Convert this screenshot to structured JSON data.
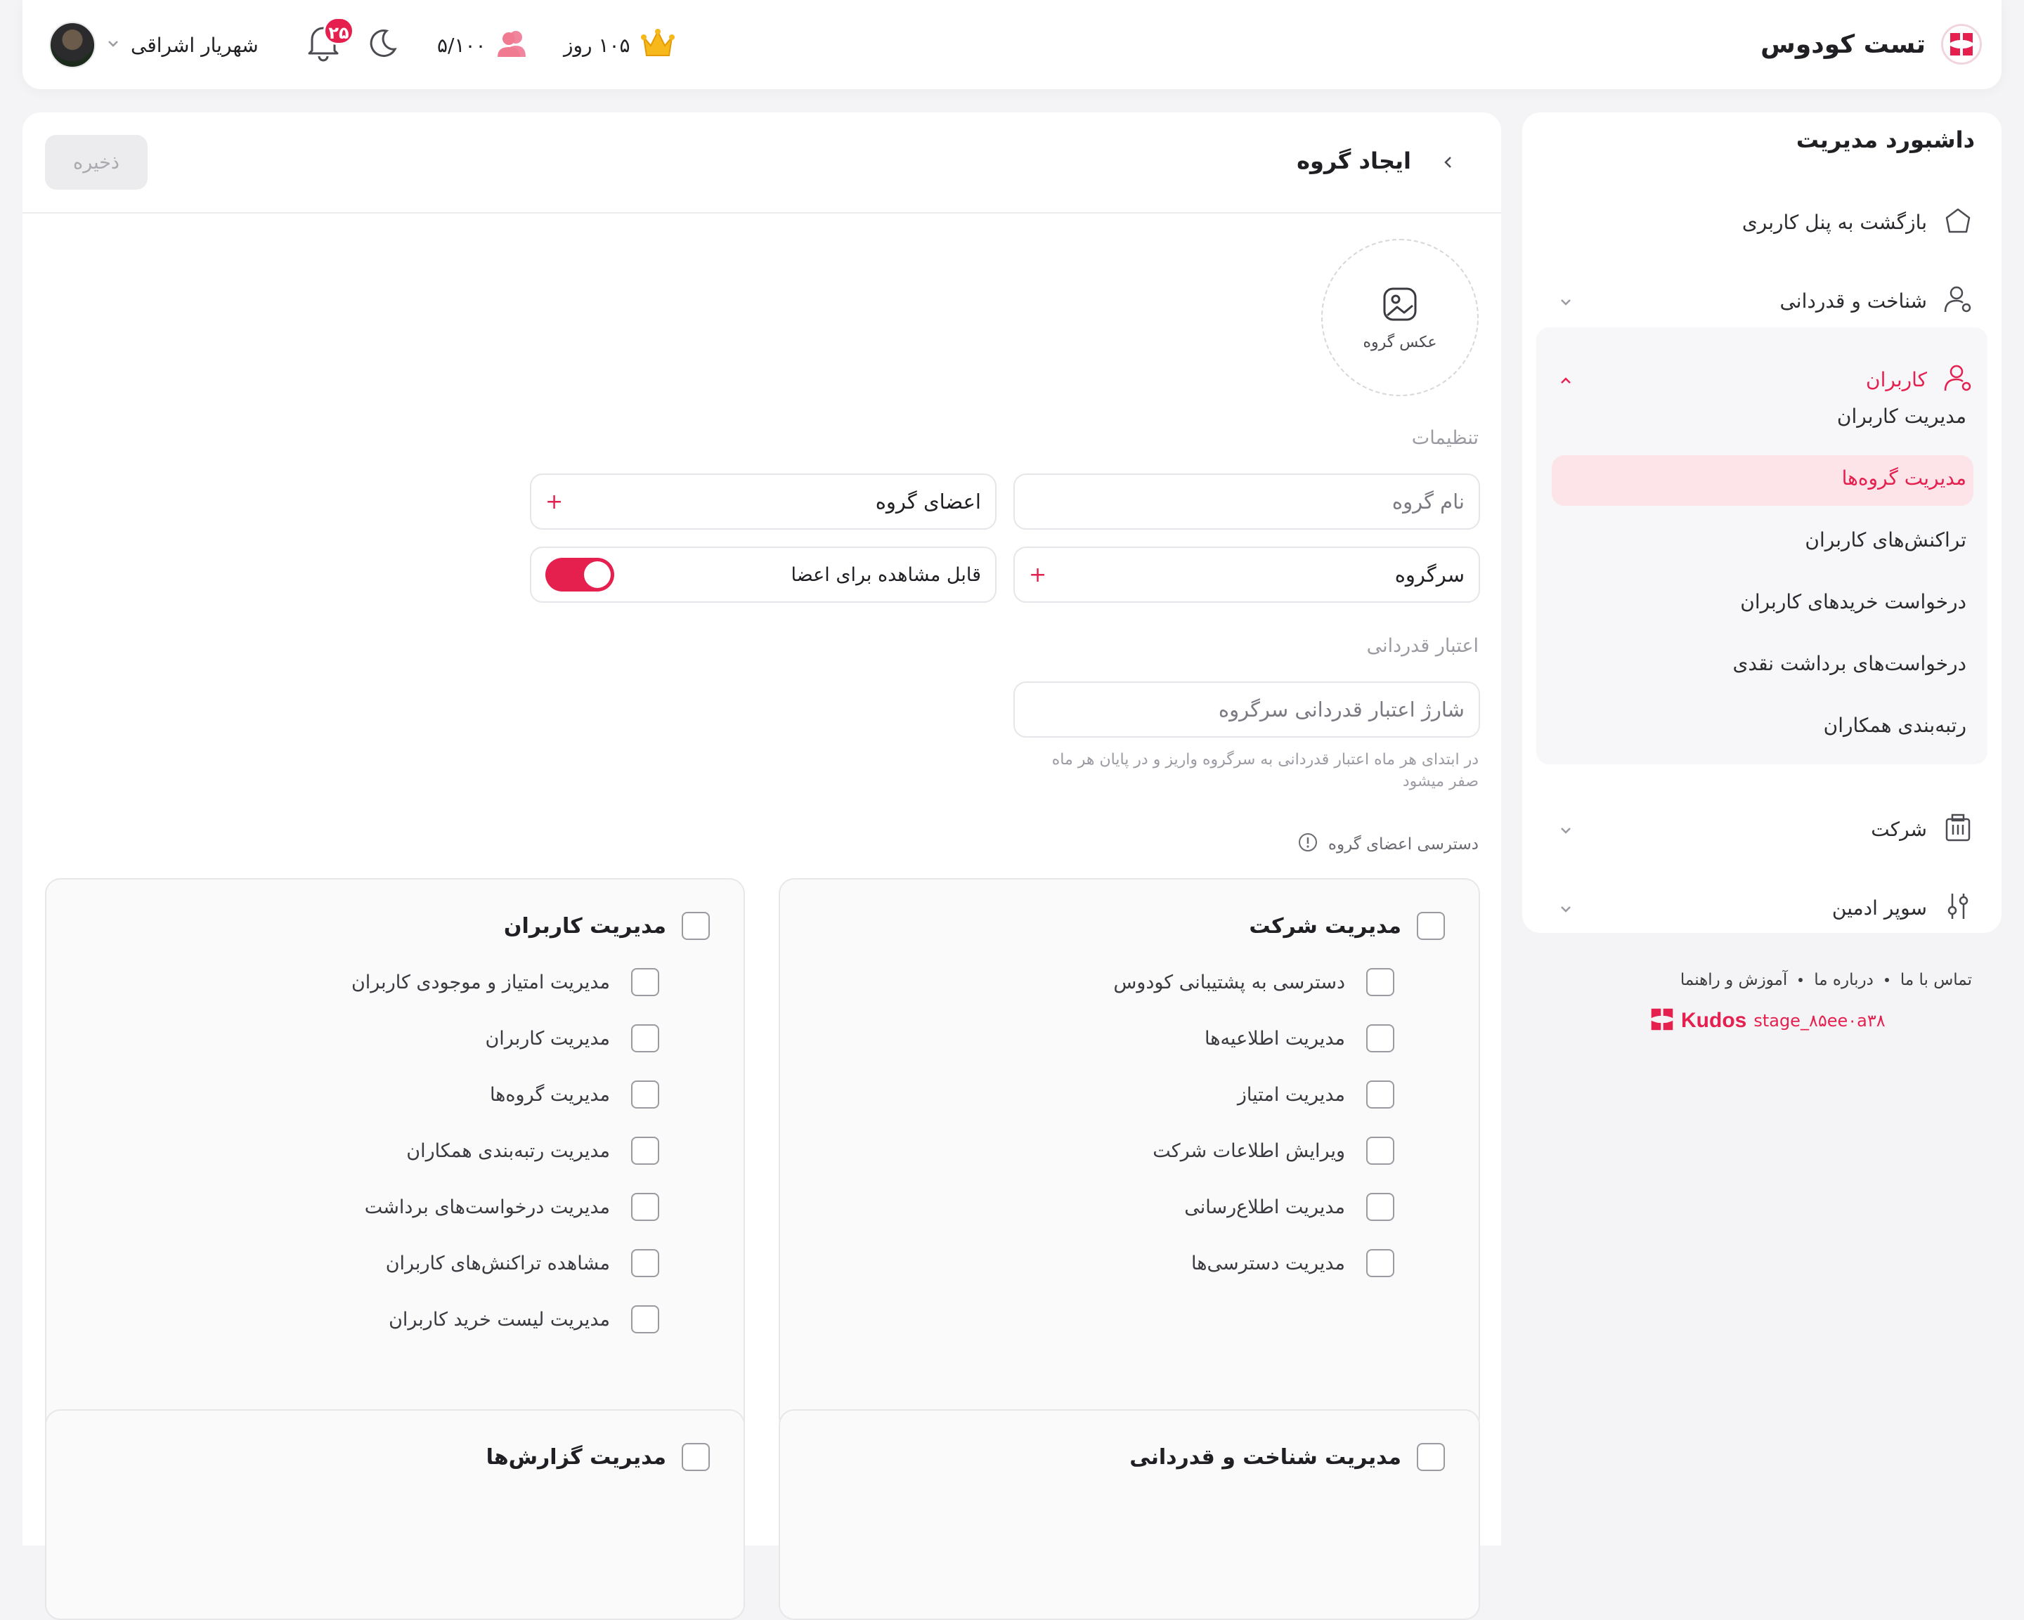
{
  "header": {
    "brand_name": "تست کودوس",
    "days": "۱۰۵ روز",
    "members": "۵/۱۰۰",
    "notifications_count": "۲۵",
    "user_name": "شهریار اشراقی"
  },
  "sidebar": {
    "title": "داشبورد مدیریت",
    "back_to_panel": "بازگشت به پنل کاربری",
    "recognition": "شناخت و قدردانی",
    "users": "کاربران",
    "sub_items": [
      "مدیریت کاربران",
      "مدیریت گروه‌ها",
      "تراکنش‌های کاربران",
      "درخواست خریدهای کاربران",
      "درخواست‌های برداشت نقدی",
      "رتبه‌بندی همکاران"
    ],
    "company": "شرکت",
    "super_admin": "سوپر ادمین"
  },
  "footer": {
    "contact": "تماس با ما",
    "about": "درباره ما",
    "help": "آموزش و راهنما",
    "version": "stage_۸۵ee۰a۳۸",
    "logo_text": "Kudos"
  },
  "page": {
    "title": "ایجاد گروه",
    "save": "ذخیره",
    "photo_label": "عکس گروه",
    "settings_label": "تنظیمات",
    "group_name_placeholder": "نام گروه",
    "group_members": "اعضای گروه",
    "supervisor": "سرگروه",
    "visible_for_members": "قابل مشاهده برای اعضا",
    "visible_toggle_on": true,
    "credit_label": "اعتبار قدردانی",
    "credit_placeholder": "شارژ اعتبار قدردانی سرگروه",
    "credit_hint": "در ابتدای هر ماه اعتبار قدردانی به سرگروه واریز و در پایان هر ماه صفر میشود",
    "access_label": "دسترسی اعضای گروه"
  },
  "permissions": {
    "company": {
      "title": "مدیریت شرکت",
      "items": [
        "دسترسی به پشتیبانی کودوس",
        "مدیریت اطلاعیه‌ها",
        "مدیریت امتیاز",
        "ویرایش اطلاعات شرکت",
        "مدیریت اطلاع‌رسانی",
        "مدیریت دسترسی‌ها"
      ]
    },
    "users": {
      "title": "مدیریت کاربران",
      "items": [
        "مدیریت امتیاز و موجودی کاربران",
        "مدیریت کاربران",
        "مدیریت گروه‌ها",
        "مدیریت رتبه‌بندی همکاران",
        "مدیریت درخواست‌های برداشت",
        "مشاهده تراکنش‌های کاربران",
        "مدیریت لیست خرید کاربران"
      ]
    },
    "recognition": {
      "title": "مدیریت شناخت و قدردانی"
    },
    "reports": {
      "title": "مدیریت گزارش‌ها"
    }
  },
  "colors": {
    "accent": "#e5204f",
    "accent_soft": "#fde4e9"
  }
}
